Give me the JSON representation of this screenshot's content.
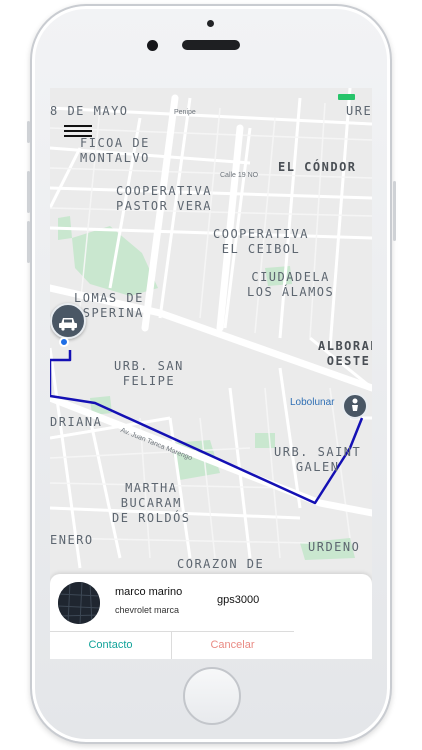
{
  "map": {
    "labels": {
      "ocho_de_mayo": "8 DE MAYO",
      "ficoa": "FICOA DE\nMONTALVO",
      "el_condor": "EL CÓNDOR",
      "ure": "URE",
      "coop_pastor": "COOPERATIVA\nPASTOR VERA",
      "coop_ceibol": "COOPERATIVA\nEL CEIBOL",
      "ciudadela": "CIUDADELA\nLOS ÁLAMOS",
      "lomas": "LOMAS DE\nOSPERINA",
      "alborada": "ALBORAD\nOESTE",
      "urb_san_felipe": "URB. SAN\nFELIPE",
      "adriana": "DRIANA",
      "urb_saint": "URB. SAINT\nGALEN",
      "martha": "MARTHA\nBUCARAM\nDE ROLDÓS",
      "enero": "ENERO",
      "urdeno": "URDENO",
      "corazon": "CORAZON DE"
    },
    "streets": {
      "penipe": "Penipe",
      "calle19": "Calle 19 NO",
      "juan_tanca": "Av. Juan Tanca Marengo"
    },
    "poi": "Lobolunar"
  },
  "driver": {
    "name": "marco marino",
    "vehicle": "chevrolet marca",
    "plate": "gps3000"
  },
  "actions": {
    "contact": "Contacto",
    "cancel": "Cancelar"
  },
  "colors": {
    "route": "#1410b4",
    "contact": "#12a39a",
    "cancel": "#e98a83",
    "battery": "#27c46a"
  }
}
